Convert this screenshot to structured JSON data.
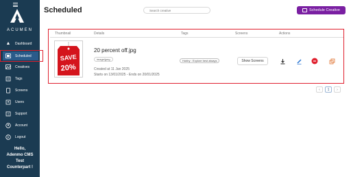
{
  "sidebar": {
    "brand": "ACUMEN",
    "items": [
      {
        "label": "Dashboard",
        "icon": "dashboard-icon"
      },
      {
        "label": "Scheduled",
        "icon": "scheduled-icon",
        "active": true
      },
      {
        "label": "Creatives",
        "icon": "creatives-icon"
      },
      {
        "label": "Tags",
        "icon": "tag-icon"
      },
      {
        "label": "Screens",
        "icon": "screen-icon"
      },
      {
        "label": "Users",
        "icon": "users-icon"
      },
      {
        "label": "Support",
        "icon": "support-icon"
      },
      {
        "label": "Account",
        "icon": "account-icon"
      },
      {
        "label": "Logout",
        "icon": "logout-icon"
      }
    ],
    "greeting_lines": [
      "Hello,",
      "Adenmo CMS",
      "Test",
      "Counterpart !"
    ]
  },
  "header": {
    "title": "Scheduled",
    "search_placeholder": "Search creative",
    "schedule_button": "Schedule Creative"
  },
  "table": {
    "columns": [
      "Thumbnail",
      "Details",
      "Tags",
      "Screens",
      "Actions"
    ],
    "rows": [
      {
        "thumbnail_text": [
          "SAVE",
          "20%"
        ],
        "file_name": "20 percent off.jpg",
        "file_type": "image/jpeg",
        "created": "Created at 11 Jan 2025",
        "schedule": "Starts on 13/01/2025 - Ends on 20/01/2025",
        "tag": "Hobby : Explore best always",
        "screens_button": "Show Screens"
      }
    ]
  },
  "pagination": {
    "prev": "‹",
    "current": "1",
    "next": "›"
  },
  "colors": {
    "sidebar_bg": "#1b3b52",
    "accent_purple": "#7a1fa2",
    "highlight_red": "#e0202e"
  }
}
